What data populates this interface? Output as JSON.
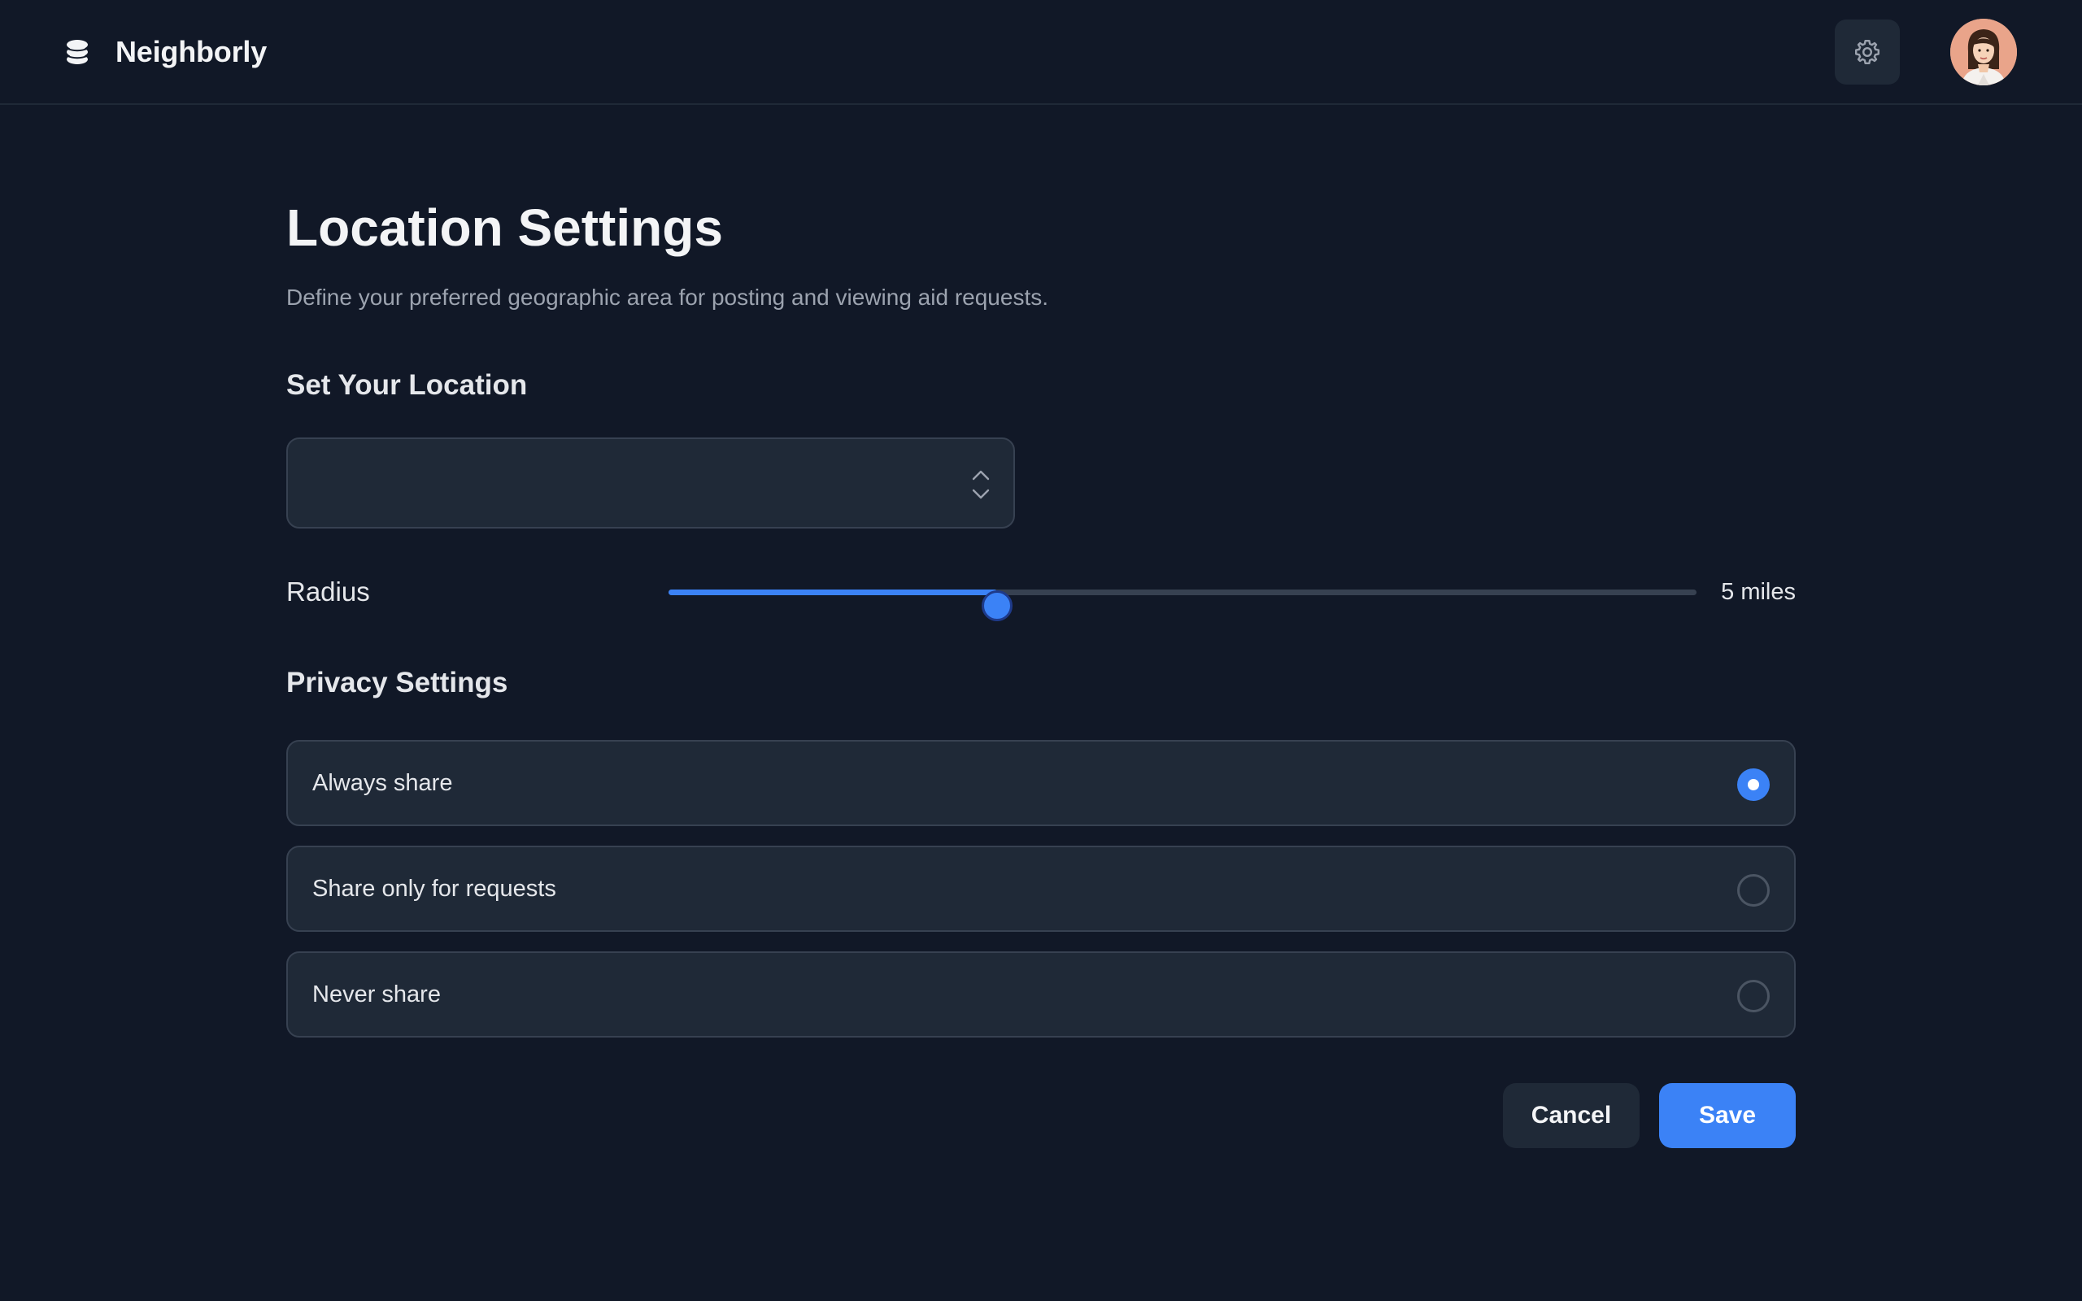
{
  "app": {
    "name": "Neighborly"
  },
  "header": {
    "settings_icon": "gear-icon",
    "avatar_icon": "user-avatar"
  },
  "page": {
    "title": "Location Settings",
    "subtitle": "Define your preferred geographic area for posting and viewing aid requests."
  },
  "location": {
    "heading": "Set Your Location",
    "selected_value": ""
  },
  "radius": {
    "label": "Radius",
    "value_text": "5 miles",
    "fraction": 0.32
  },
  "privacy": {
    "heading": "Privacy Settings",
    "options": [
      {
        "label": "Always share",
        "selected": true
      },
      {
        "label": "Share only for requests",
        "selected": false
      },
      {
        "label": "Never share",
        "selected": false
      }
    ]
  },
  "actions": {
    "cancel_label": "Cancel",
    "save_label": "Save"
  },
  "colors": {
    "background": "#111827",
    "surface": "#1f2937",
    "accent": "#3b82f6",
    "border": "#374151"
  }
}
